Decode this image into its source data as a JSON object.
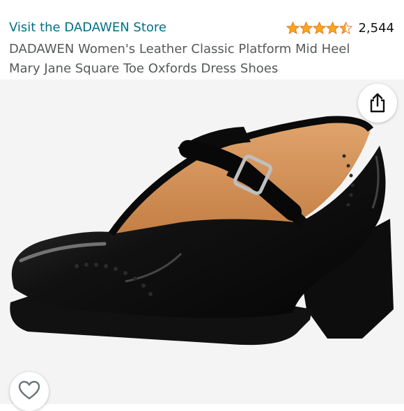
{
  "store": {
    "link_text": "Visit the DADAWEN Store"
  },
  "rating": {
    "stars": 4.5,
    "count": "2,544",
    "star_color": "#ffa41c"
  },
  "product": {
    "title": "DADAWEN Women's Leather Classic Platform Mid Heel\nMary Jane Square Toe Oxfords Dress Shoes"
  },
  "image": {
    "subject": "black patent leather mary jane platform heel shoe"
  },
  "actions": {
    "share_icon": "share-icon",
    "like_icon": "heart-icon"
  },
  "colors": {
    "link": "#007185",
    "title": "#565959",
    "background": "#f4f4f4"
  }
}
